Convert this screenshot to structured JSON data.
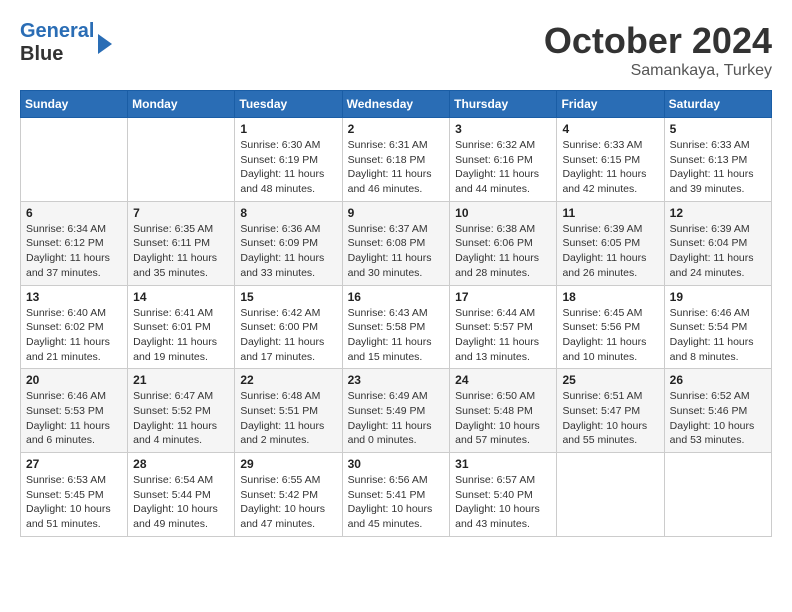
{
  "logo": {
    "line1": "General",
    "line2": "Blue"
  },
  "title": "October 2024",
  "subtitle": "Samankaya, Turkey",
  "days_of_week": [
    "Sunday",
    "Monday",
    "Tuesday",
    "Wednesday",
    "Thursday",
    "Friday",
    "Saturday"
  ],
  "weeks": [
    [
      {
        "day": "",
        "info": ""
      },
      {
        "day": "",
        "info": ""
      },
      {
        "day": "1",
        "info": "Sunrise: 6:30 AM\nSunset: 6:19 PM\nDaylight: 11 hours and 48 minutes."
      },
      {
        "day": "2",
        "info": "Sunrise: 6:31 AM\nSunset: 6:18 PM\nDaylight: 11 hours and 46 minutes."
      },
      {
        "day": "3",
        "info": "Sunrise: 6:32 AM\nSunset: 6:16 PM\nDaylight: 11 hours and 44 minutes."
      },
      {
        "day": "4",
        "info": "Sunrise: 6:33 AM\nSunset: 6:15 PM\nDaylight: 11 hours and 42 minutes."
      },
      {
        "day": "5",
        "info": "Sunrise: 6:33 AM\nSunset: 6:13 PM\nDaylight: 11 hours and 39 minutes."
      }
    ],
    [
      {
        "day": "6",
        "info": "Sunrise: 6:34 AM\nSunset: 6:12 PM\nDaylight: 11 hours and 37 minutes."
      },
      {
        "day": "7",
        "info": "Sunrise: 6:35 AM\nSunset: 6:11 PM\nDaylight: 11 hours and 35 minutes."
      },
      {
        "day": "8",
        "info": "Sunrise: 6:36 AM\nSunset: 6:09 PM\nDaylight: 11 hours and 33 minutes."
      },
      {
        "day": "9",
        "info": "Sunrise: 6:37 AM\nSunset: 6:08 PM\nDaylight: 11 hours and 30 minutes."
      },
      {
        "day": "10",
        "info": "Sunrise: 6:38 AM\nSunset: 6:06 PM\nDaylight: 11 hours and 28 minutes."
      },
      {
        "day": "11",
        "info": "Sunrise: 6:39 AM\nSunset: 6:05 PM\nDaylight: 11 hours and 26 minutes."
      },
      {
        "day": "12",
        "info": "Sunrise: 6:39 AM\nSunset: 6:04 PM\nDaylight: 11 hours and 24 minutes."
      }
    ],
    [
      {
        "day": "13",
        "info": "Sunrise: 6:40 AM\nSunset: 6:02 PM\nDaylight: 11 hours and 21 minutes."
      },
      {
        "day": "14",
        "info": "Sunrise: 6:41 AM\nSunset: 6:01 PM\nDaylight: 11 hours and 19 minutes."
      },
      {
        "day": "15",
        "info": "Sunrise: 6:42 AM\nSunset: 6:00 PM\nDaylight: 11 hours and 17 minutes."
      },
      {
        "day": "16",
        "info": "Sunrise: 6:43 AM\nSunset: 5:58 PM\nDaylight: 11 hours and 15 minutes."
      },
      {
        "day": "17",
        "info": "Sunrise: 6:44 AM\nSunset: 5:57 PM\nDaylight: 11 hours and 13 minutes."
      },
      {
        "day": "18",
        "info": "Sunrise: 6:45 AM\nSunset: 5:56 PM\nDaylight: 11 hours and 10 minutes."
      },
      {
        "day": "19",
        "info": "Sunrise: 6:46 AM\nSunset: 5:54 PM\nDaylight: 11 hours and 8 minutes."
      }
    ],
    [
      {
        "day": "20",
        "info": "Sunrise: 6:46 AM\nSunset: 5:53 PM\nDaylight: 11 hours and 6 minutes."
      },
      {
        "day": "21",
        "info": "Sunrise: 6:47 AM\nSunset: 5:52 PM\nDaylight: 11 hours and 4 minutes."
      },
      {
        "day": "22",
        "info": "Sunrise: 6:48 AM\nSunset: 5:51 PM\nDaylight: 11 hours and 2 minutes."
      },
      {
        "day": "23",
        "info": "Sunrise: 6:49 AM\nSunset: 5:49 PM\nDaylight: 11 hours and 0 minutes."
      },
      {
        "day": "24",
        "info": "Sunrise: 6:50 AM\nSunset: 5:48 PM\nDaylight: 10 hours and 57 minutes."
      },
      {
        "day": "25",
        "info": "Sunrise: 6:51 AM\nSunset: 5:47 PM\nDaylight: 10 hours and 55 minutes."
      },
      {
        "day": "26",
        "info": "Sunrise: 6:52 AM\nSunset: 5:46 PM\nDaylight: 10 hours and 53 minutes."
      }
    ],
    [
      {
        "day": "27",
        "info": "Sunrise: 6:53 AM\nSunset: 5:45 PM\nDaylight: 10 hours and 51 minutes."
      },
      {
        "day": "28",
        "info": "Sunrise: 6:54 AM\nSunset: 5:44 PM\nDaylight: 10 hours and 49 minutes."
      },
      {
        "day": "29",
        "info": "Sunrise: 6:55 AM\nSunset: 5:42 PM\nDaylight: 10 hours and 47 minutes."
      },
      {
        "day": "30",
        "info": "Sunrise: 6:56 AM\nSunset: 5:41 PM\nDaylight: 10 hours and 45 minutes."
      },
      {
        "day": "31",
        "info": "Sunrise: 6:57 AM\nSunset: 5:40 PM\nDaylight: 10 hours and 43 minutes."
      },
      {
        "day": "",
        "info": ""
      },
      {
        "day": "",
        "info": ""
      }
    ]
  ]
}
